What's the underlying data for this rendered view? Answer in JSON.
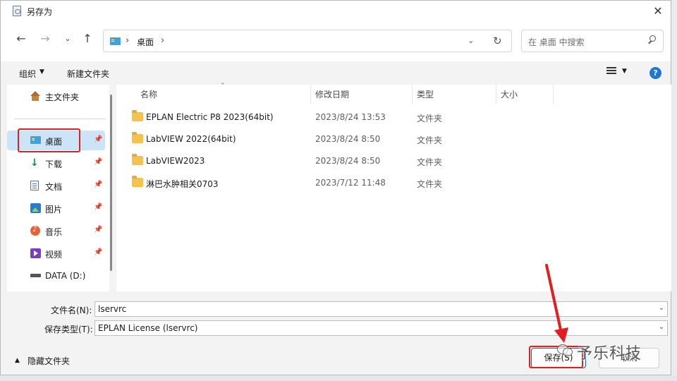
{
  "window": {
    "title": "另存为",
    "close_glyph": "✕"
  },
  "nav": {
    "back_glyph": "←",
    "forward_glyph": "→",
    "recent_glyph": "⌄",
    "up_glyph": "↑"
  },
  "address": {
    "separator": "›",
    "location": "桌面",
    "dropdown_glyph": "⌄",
    "refresh_glyph": "↻"
  },
  "search": {
    "placeholder": "在 桌面 中搜索"
  },
  "toolbar": {
    "organize": "组织",
    "organize_arrow": "▼",
    "new_folder": "新建文件夹",
    "view_arrow": "▼",
    "help": "?"
  },
  "sidebar": {
    "items": [
      {
        "label": "主文件夹",
        "icon": "home-icon"
      },
      {
        "label": "桌面",
        "icon": "desktop-icon",
        "selected": true,
        "pinned": true
      },
      {
        "label": "下载",
        "icon": "download-icon",
        "pinned": true
      },
      {
        "label": "文档",
        "icon": "documents-icon",
        "pinned": true
      },
      {
        "label": "图片",
        "icon": "pictures-icon",
        "pinned": true
      },
      {
        "label": "音乐",
        "icon": "music-icon",
        "pinned": true
      },
      {
        "label": "视频",
        "icon": "video-icon",
        "pinned": true
      },
      {
        "label": "DATA (D:)",
        "icon": "drive-icon"
      }
    ],
    "pin_glyph": "📌"
  },
  "filelist": {
    "sort_arrow": "⌃",
    "columns": {
      "name": "名称",
      "modified": "修改日期",
      "type": "类型",
      "size": "大小"
    },
    "rows": [
      {
        "name": "EPLAN Electric P8 2023(64bit)",
        "modified": "2023/8/24 13:53",
        "type": "文件夹"
      },
      {
        "name": "LabVIEW 2022(64bit)",
        "modified": "2023/8/24 8:50",
        "type": "文件夹"
      },
      {
        "name": "LabVIEW2023",
        "modified": "2023/8/24 8:50",
        "type": "文件夹"
      },
      {
        "name": "淋巴水肿相关0703",
        "modified": "2023/7/12 11:48",
        "type": "文件夹"
      }
    ]
  },
  "form": {
    "filename_label": "文件名(N):",
    "filename_value": "lservrc",
    "filetype_label": "保存类型(T):",
    "filetype_value": "EPLAN License (lservrc)",
    "dropdown_glyph": "⌄"
  },
  "footer": {
    "hide_folders_arrow": "▲",
    "hide_folders": "隐藏文件夹",
    "save": "保存(S)",
    "cancel": "取消"
  },
  "watermark": {
    "text": "予乐科技"
  },
  "colors": {
    "accent": "#0067c0",
    "highlight": "#e02020",
    "selected": "#cce4f7",
    "folder": "#f5c24f"
  }
}
